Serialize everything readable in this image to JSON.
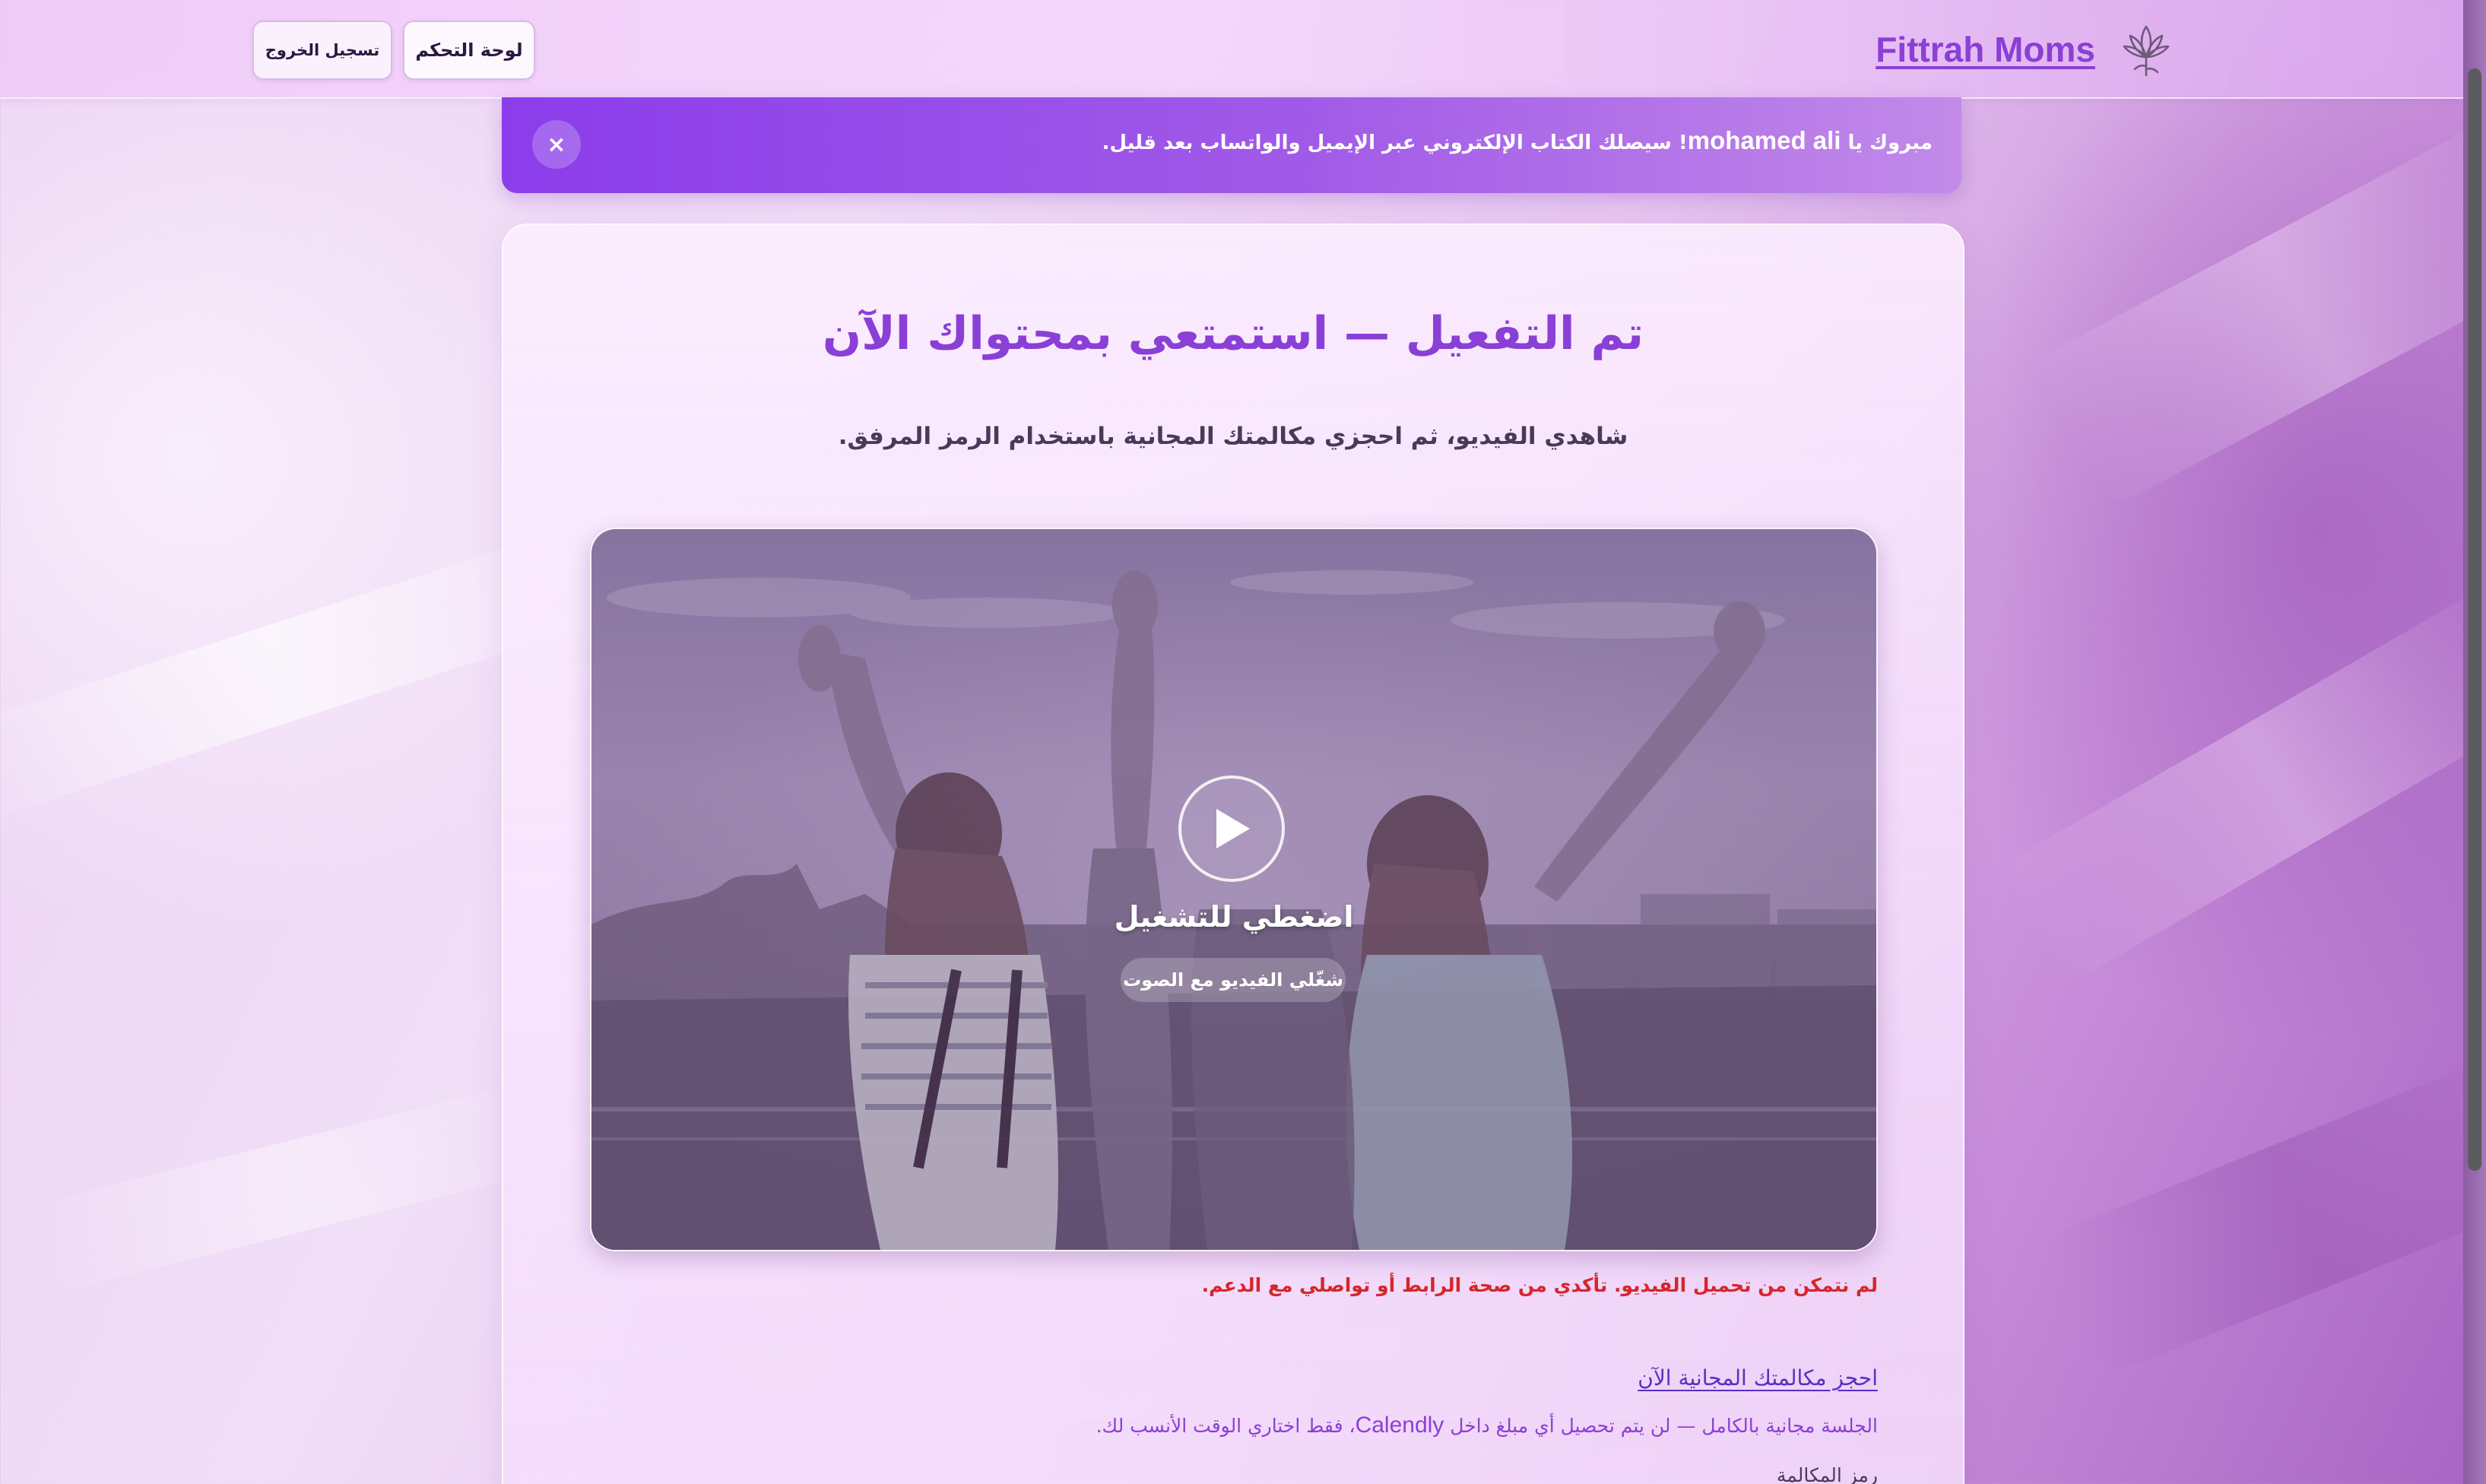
{
  "header": {
    "brand_name": "Fittrah Moms",
    "brand_logo_icon": "lotus-logo-icon",
    "dashboard_label": "لوحة التحكم",
    "logout_label": "تسجيل الخروج"
  },
  "banner": {
    "prefix": "مبروك يا ",
    "user_name": "mohamed ali",
    "message": "! سيصلك الكتاب الإلكتروني عبر الإيميل والواتساب بعد قليل.",
    "close_label": "×"
  },
  "main": {
    "title": "تم التفعيل — استمتعي بمحتواك الآن",
    "subtitle": "شاهدي الفيديو، ثم احجزي مكالمتك المجانية باستخدام الرمز المرفق.",
    "video": {
      "play_icon": "play-icon",
      "play_label": "اضغطي للتشغيل",
      "sound_hint": "شغّلي الفيديو مع الصوت"
    },
    "video_error": "لم نتمكن من تحميل الفيديو. تأكدي من صحة الرابط أو تواصلي مع الدعم.",
    "booking": {
      "link_label": "احجز مكالمتك المجانية الآن",
      "note_part1": "الجلسة مجانية بالكامل — لن يتم تحصيل أي مبلغ داخل ",
      "note_brand": "Calendly",
      "note_part2": "، فقط اختاري الوقت الأنسب لك."
    },
    "cut_off_text": "رمز المكالمة"
  },
  "colors": {
    "accent": "#8a3fd6",
    "banner_start": "#8b3dea",
    "banner_end": "#c28ae9",
    "error": "#d6262a",
    "link": "#5a2ec4"
  }
}
